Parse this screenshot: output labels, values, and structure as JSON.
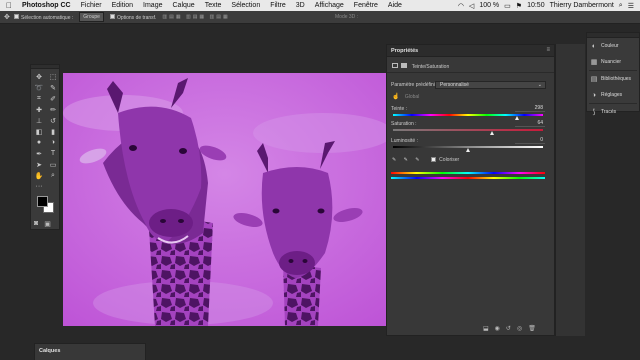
{
  "menubar": {
    "apple_icon": "",
    "app_name": "Photoshop CC",
    "items": [
      "Fichier",
      "Edition",
      "Image",
      "Calque",
      "Texte",
      "Sélection",
      "Filtre",
      "3D",
      "Affichage",
      "Fenêtre",
      "Aide"
    ],
    "battery": "100 %",
    "time": "10:50",
    "user": "Thierry Dambermont"
  },
  "options_bar": {
    "auto_select_label": "Sélection automatique :",
    "auto_select_value": "Groupe",
    "transform_label": "Options de transf.",
    "mode_3d_label": "Mode 3D :"
  },
  "properties": {
    "title": "Propriétés",
    "adjustment_name": "Teinte/Saturation",
    "preset_label": "Paramètre prédéfini :",
    "preset_value": "Personnalisé",
    "channel_value": "Global",
    "hue_label": "Teinte :",
    "hue_value": "298",
    "saturation_label": "Saturation :",
    "saturation_value": "64",
    "lightness_label": "Luminosité :",
    "lightness_value": "0",
    "colorize_label": "Coloriser",
    "colorize_checked": true,
    "slider_positions": {
      "hue": 0.83,
      "saturation": 0.66,
      "lightness": 0.5
    }
  },
  "dock": {
    "items": [
      {
        "label": "Couleur",
        "icon": "color-wheel-icon"
      },
      {
        "label": "Nuancier",
        "icon": "swatches-icon"
      },
      {
        "label": "Bibliothèques",
        "icon": "libraries-icon"
      },
      {
        "label": "Réglages",
        "icon": "adjustments-icon"
      },
      {
        "label": "Tracés",
        "icon": "paths-icon"
      }
    ]
  },
  "layers_panel": {
    "title": "Calques"
  },
  "colors": {
    "canvas_tint": "#c562dc",
    "giraffe_dark": "#5a1870",
    "giraffe_mid": "#a646c2",
    "panel_bg": "#383838"
  }
}
